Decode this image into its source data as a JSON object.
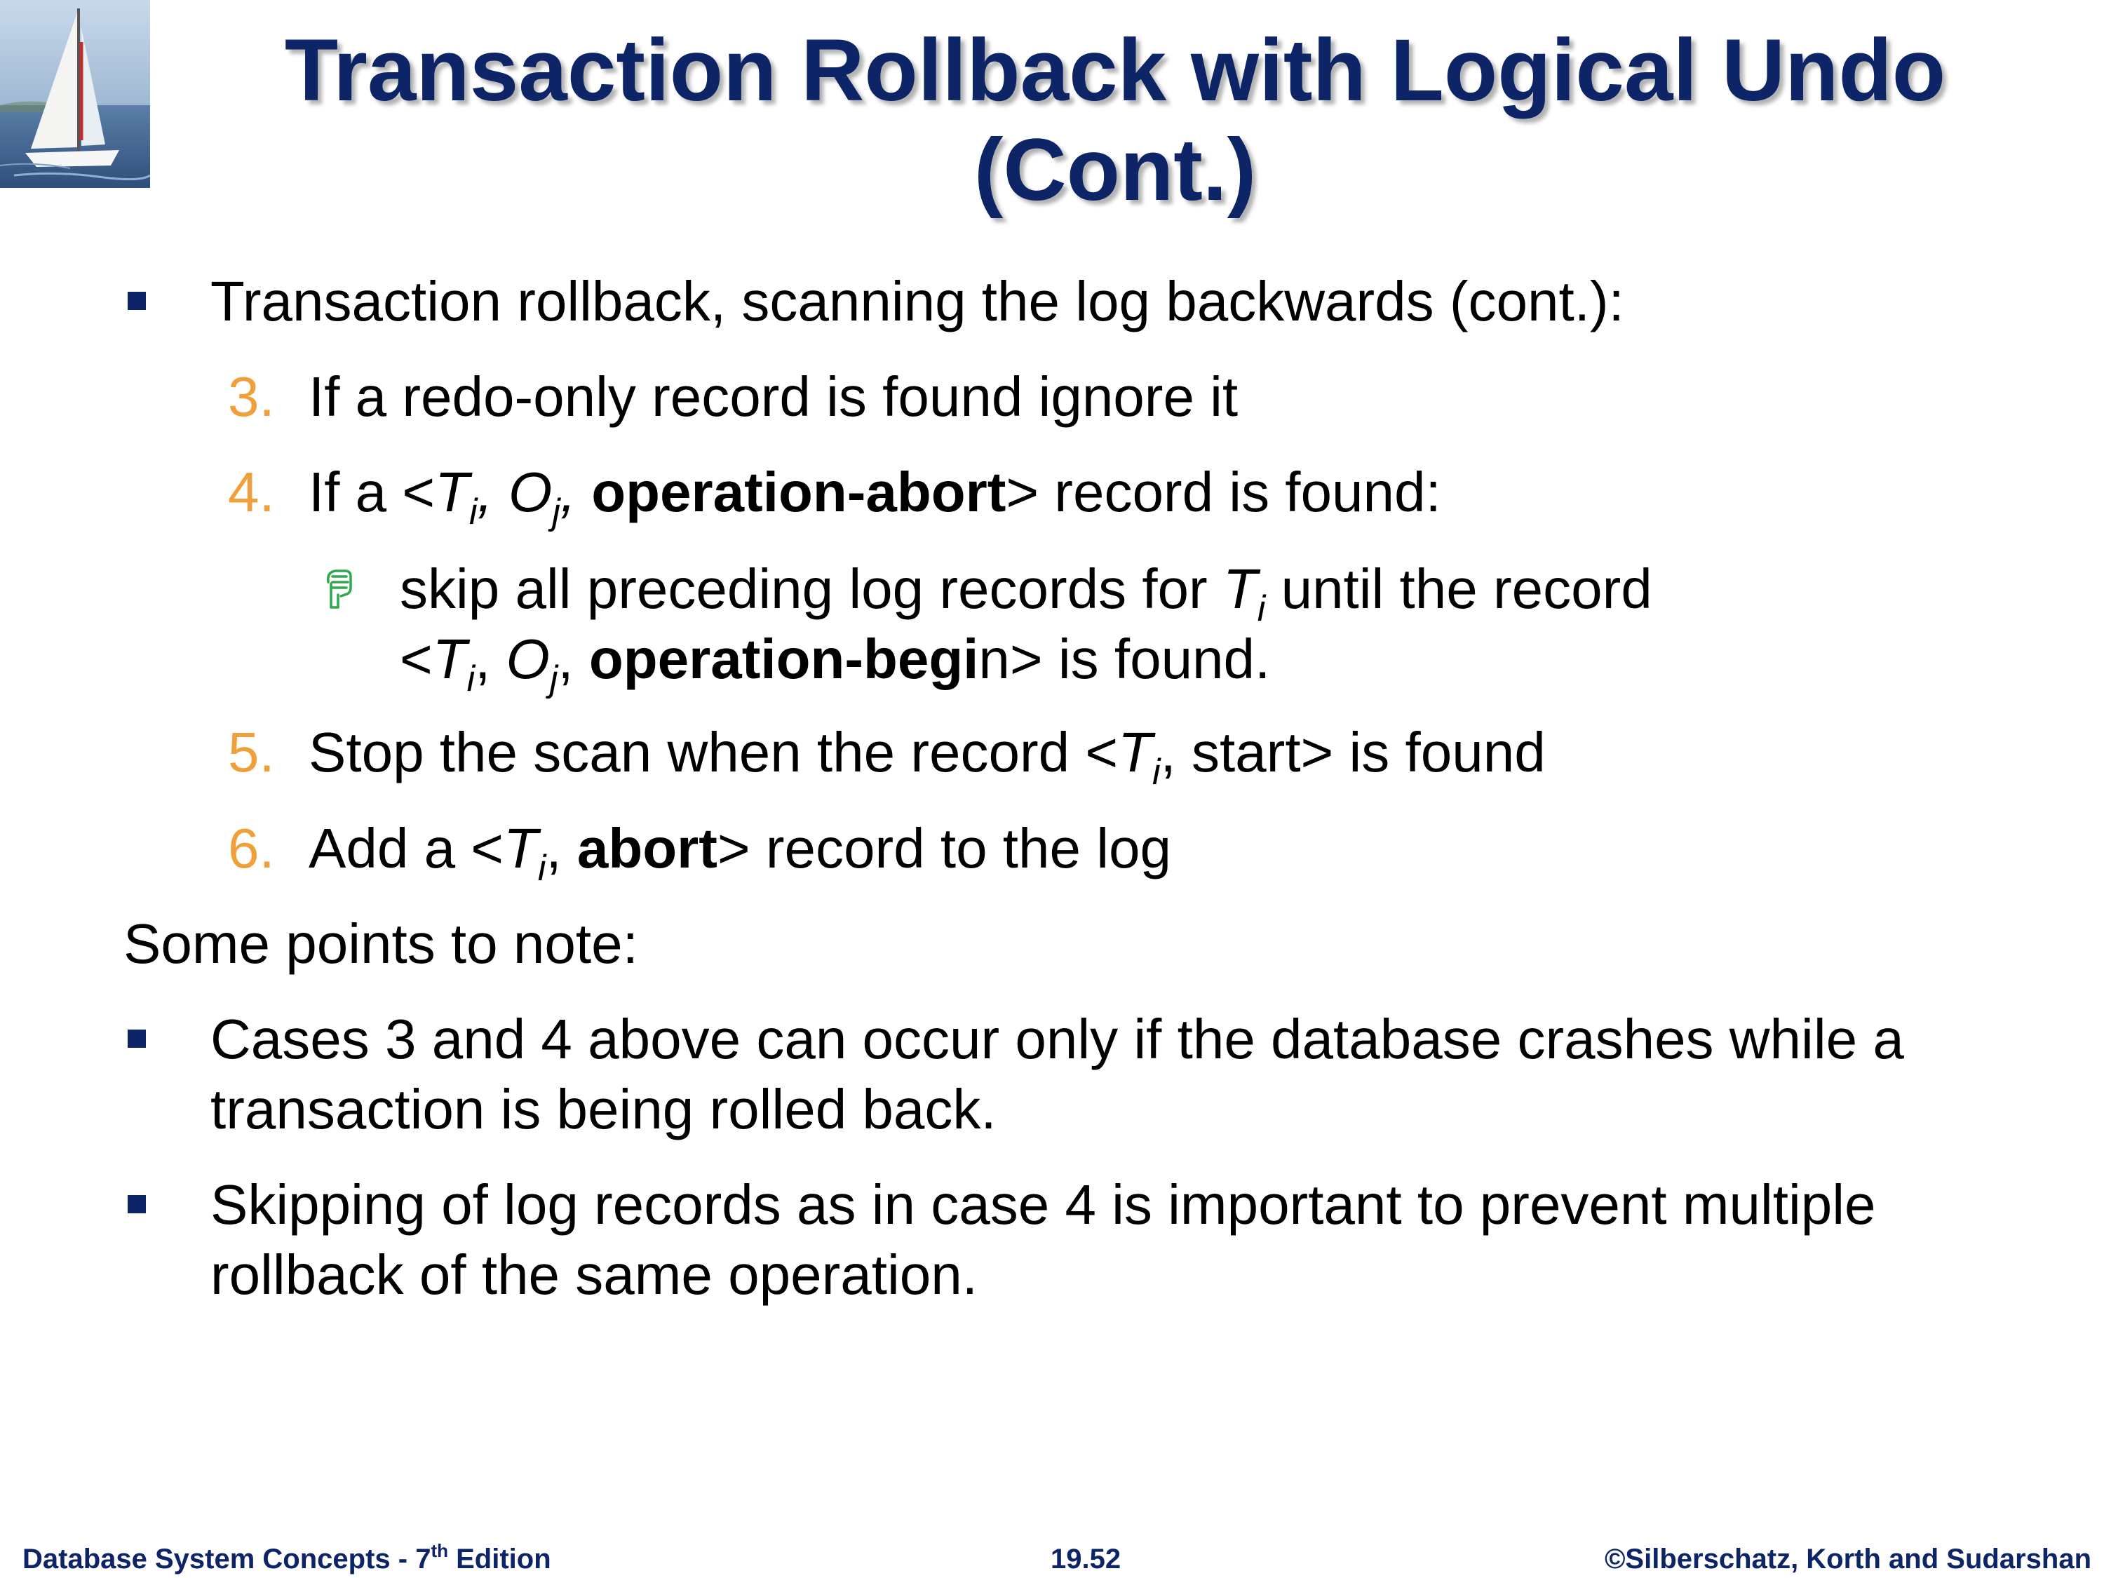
{
  "title": {
    "line1": "Transaction Rollback with Logical Undo",
    "line2": "(Cont.)"
  },
  "bullet1": {
    "text": "Transaction rollback, scanning the log backwards (cont.):"
  },
  "steps": [
    {
      "num": "3.",
      "text": "If a redo-only record is found ignore it"
    },
    {
      "num": "4.",
      "pre": "If a <",
      "T": "T",
      "i": "i",
      "sep1": ", ",
      "O": "O",
      "j": "j",
      "sep2": ", ",
      "bold": "operation-abort",
      "post": "> record is found:"
    },
    {
      "num": "5.",
      "pre": "Stop the scan when the record <",
      "T": "T",
      "i": "i",
      "post": ", start> is found"
    },
    {
      "num": "6.",
      "pre": "Add a <",
      "T": "T",
      "i": "i",
      "sep": ",  ",
      "bold": "abort",
      "post": "> record to the log"
    }
  ],
  "sub_bullet": {
    "line1_pre": "skip all preceding log records for ",
    "T": "T",
    "i": "i",
    "line1_post": "  until the record",
    "line2_pre": "<",
    "sep1": ", ",
    "O": "O",
    "j": "j",
    "sep2": ", ",
    "bold": "operation-begi",
    "line2_post": "n> is found."
  },
  "note_heading": "Some points to note:",
  "notes": [
    {
      "line1": "Cases 3 and 4 above can occur only if the database crashes while a",
      "line2": "transaction is being rolled back."
    },
    {
      "line1": "Skipping of log records as in case 4 is important to prevent multiple",
      "line2": "rollback of the same operation."
    }
  ],
  "footer": {
    "left": "Database System Concepts - 7",
    "left_sup": "th",
    "left_end": " Edition",
    "center": "19.52",
    "right": "©Silberschatz, Korth and Sudarshan"
  },
  "colors": {
    "title": "#0d2466",
    "bullet": "#0d2466",
    "step_number": "#f0a03a",
    "sub_bullet_icon": "#2fa84f"
  },
  "icons": {
    "logo": "sailboat-logo",
    "sub_bullet": "pointing-hand-icon"
  }
}
